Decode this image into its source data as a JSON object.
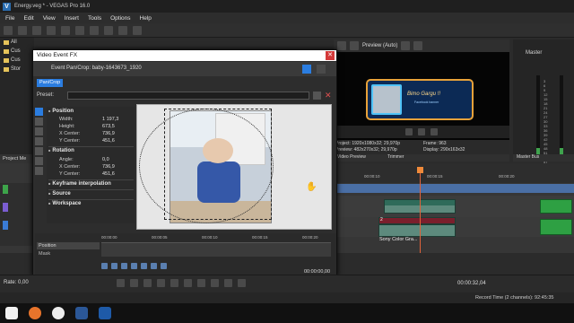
{
  "window": {
    "title": "Energy.veg * - VEGAS Pro 16.0"
  },
  "menu": [
    "File",
    "Edit",
    "View",
    "Insert",
    "Tools",
    "Options",
    "Help"
  ],
  "explorer": {
    "tab": "Import Media...",
    "items": [
      "All",
      "Cus",
      "Cus",
      "Stor"
    ],
    "project_tab": "Project Me"
  },
  "preview": {
    "mode_label": "Preview (Auto)",
    "title_text": "Bimo Gargu !!",
    "subtitle_text": "Facebook banner",
    "info": {
      "project": "Project: 1920x1080x32; 29,970p",
      "preview": "Preview: 482x270x32; 29,970p",
      "video_preview_tab": "Video Preview",
      "trimmer_tab": "Trimmer",
      "frame": "Frame: 963",
      "display": "Display: 290x163x32"
    }
  },
  "master": {
    "title": "Master",
    "tab": "Master Bus",
    "scale": [
      "3",
      "6",
      "9",
      "12",
      "15",
      "18",
      "21",
      "24",
      "27",
      "30",
      "33",
      "36",
      "39",
      "42",
      "45",
      "48",
      "51",
      "54",
      "57"
    ],
    "levels": [
      0.15,
      0.15
    ]
  },
  "dialog": {
    "title": "Video Event FX",
    "chain_label": "Event Pan/Crop: baby-1643673_1920",
    "chip": "Pan/Crop",
    "preset_label": "Preset:",
    "sections": {
      "position": "Position",
      "rotation": "Rotation",
      "keyframe": "Keyframe interpolation",
      "source": "Source",
      "workspace": "Workspace"
    },
    "props": {
      "width": {
        "label": "Width:",
        "value": "1 197,3"
      },
      "height": {
        "label": "Height:",
        "value": "673,5"
      },
      "xcenter": {
        "label": "X Center:",
        "value": "736,9"
      },
      "ycenter": {
        "label": "Y Center:",
        "value": "451,6"
      },
      "angle": {
        "label": "Angle:",
        "value": "0,0"
      },
      "rxcenter": {
        "label": "X Center:",
        "value": "736,9"
      },
      "rycenter": {
        "label": "Y Center:",
        "value": "451,6"
      }
    },
    "keyframes": {
      "ruler": [
        "00:00:00",
        "00:00:05",
        "00:00:10",
        "00:00:15",
        "00:00:20"
      ],
      "position_label": "Position",
      "mask_label": "Mask",
      "time": "00:00:00,00"
    }
  },
  "timeline": {
    "ruler": [
      "00:00:10",
      "00:00:15",
      "00:00:20"
    ],
    "clip_label": "Sony Color Gra...",
    "track_number": "2"
  },
  "transport": {
    "rate": "Rate: 0,00",
    "time": "00:00:32,04",
    "record_time": "Record Time (2 channels): 92:45:35"
  },
  "colors": {
    "accent": "#2b7de0",
    "playhead": "#e0623a",
    "clip": "#5d8a7d",
    "loop": "#4a6fa5"
  }
}
